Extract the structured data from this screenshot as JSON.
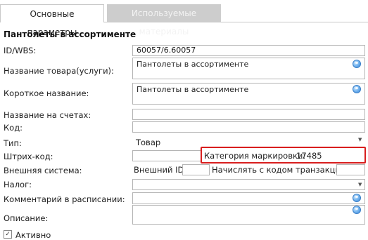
{
  "tabs": {
    "main_label": "Основные параметры",
    "materials_label": "Используемые материалы"
  },
  "section_title": "Пантолеты в ассортименте",
  "form": {
    "id_label": "ID/WBS:",
    "id_value": "60057/6.60057",
    "name_label": "Название товара(услуги):",
    "name_value": "Пантолеты в ассортименте",
    "short_name_label": "Короткое название:",
    "short_name_value": "Пантолеты в ассортименте",
    "invoice_name_label": "Название на счетах:",
    "invoice_name_value": "",
    "code_label": "Код:",
    "code_value": "",
    "type_label": "Тип:",
    "type_value": "Товар",
    "barcode_label": "Штрих-код:",
    "barcode_value": "",
    "marking_category_label": "Категория маркировки:",
    "marking_category_value": "17485",
    "external_system_label": "Внешняя система:",
    "external_id_label": "Внешний ID:",
    "external_id_value": "",
    "transaction_code_label": "Начислять с кодом транзакции:",
    "transaction_code_value": "",
    "tax_label": "Налог:",
    "tax_value": "",
    "schedule_comment_label": "Комментарий в расписании:",
    "schedule_comment_value": "",
    "description_label": "Описание:",
    "description_value": "",
    "active_label": "Активно"
  },
  "icons": {
    "translate": "globe-icon",
    "dropdown": "triangle-down"
  },
  "colors": {
    "highlight": "#d81e1e",
    "inactive_tab": "#cdcdcd",
    "globe": "#3a86d8"
  }
}
